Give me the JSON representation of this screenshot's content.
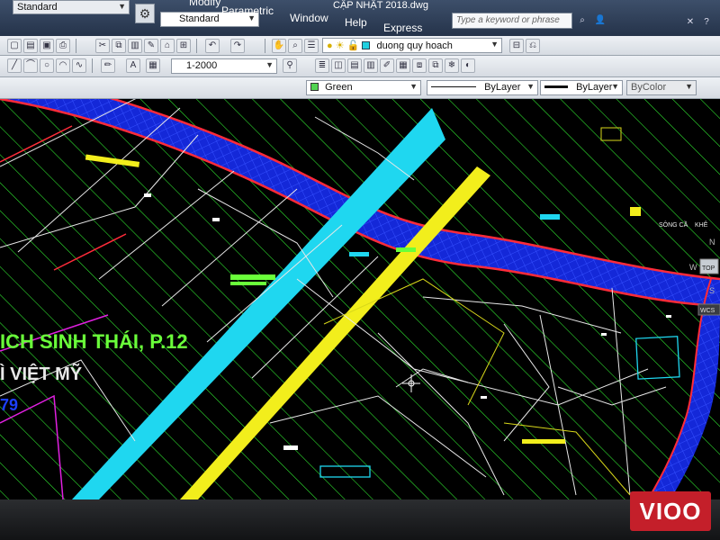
{
  "window": {
    "workspace": "Standard",
    "file_title": "CẬP NHẬT 2018.dwg",
    "menus": [
      "Modify",
      "Parametric",
      "Window",
      "Help",
      "Express"
    ],
    "help_search_placeholder": "Type a keyword or phrase",
    "sign_in": "Sign In",
    "style_standard": "Standard"
  },
  "toolbar": {
    "scale": "1-2000",
    "current_layer": "duong quy hoach",
    "color": "Green",
    "linetype": "ByLayer",
    "lineweight": "ByLayer",
    "plotstyle": "ByColor"
  },
  "drawing": {
    "label_main": "ICH SINH THÁI, P.12",
    "label_sub": "Ì VIỆT MỸ",
    "label_num": "79",
    "label_river": "SÔNG CẦ",
    "label_river2": "KHÊ"
  },
  "viewcube": {
    "top": "TOP",
    "north": "N",
    "west": "W",
    "south": "S",
    "wcs": "WCS"
  },
  "watermark": "VIOO",
  "colors": {
    "hatch": "#2ee02e",
    "road_cyan": "#1fd7f0",
    "road_yellow": "#f2ee1c",
    "river_blue": "#1428d8",
    "boundary_red": "#ff2b3a",
    "magenta": "#e020e0"
  }
}
